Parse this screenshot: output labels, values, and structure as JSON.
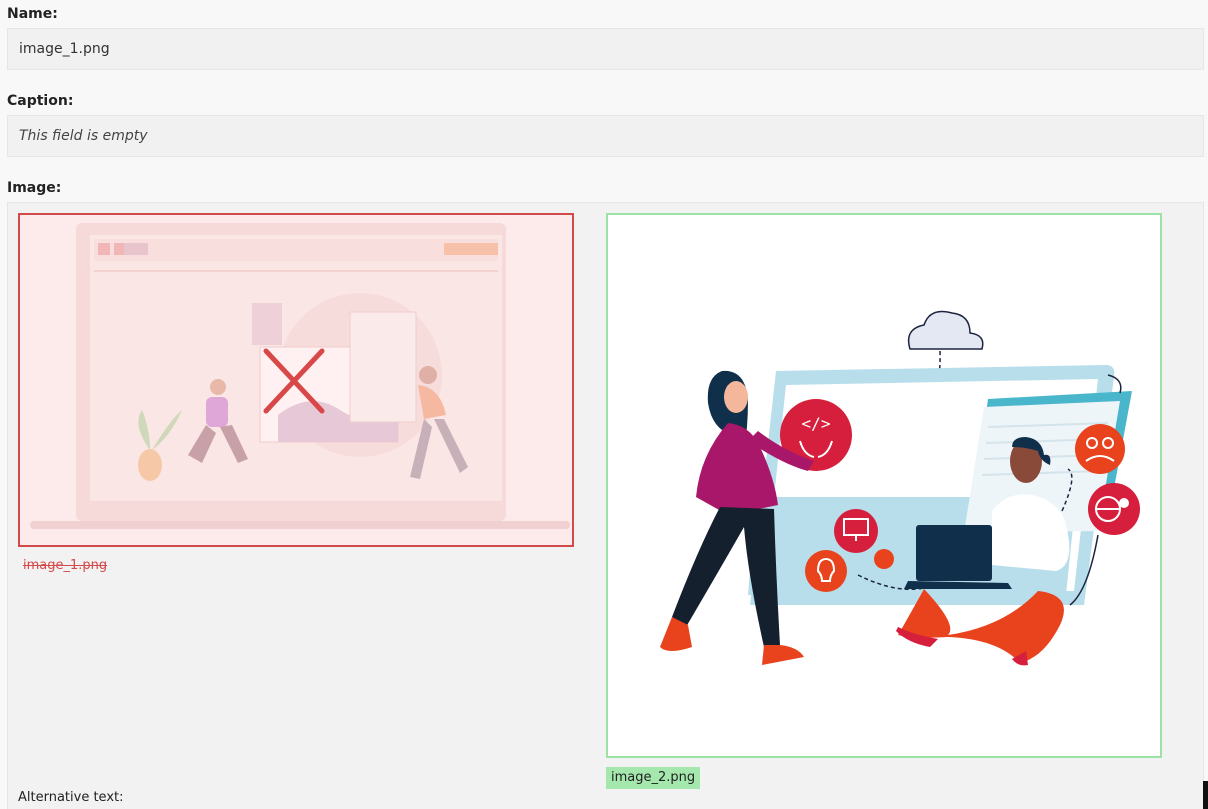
{
  "name": {
    "label": "Name:",
    "value": "image_1.png"
  },
  "caption": {
    "label": "Caption:",
    "value": "This field is empty"
  },
  "image": {
    "label": "Image:",
    "old": {
      "filename": "image_1.png",
      "status": "removed",
      "frame_color": "#d34a4a"
    },
    "new": {
      "filename": "image_2.png",
      "status": "added",
      "frame_color": "#9ce2a4"
    }
  },
  "alt_text": {
    "label": "Alternative text:"
  },
  "icons": {
    "removed_marker": "x-cross-icon",
    "cloud": "cloud-icon",
    "code": "code-icon",
    "css": "css-monitor-icon",
    "team": "team-icon",
    "global_user": "globe-user-icon",
    "idea": "idea-icon"
  }
}
